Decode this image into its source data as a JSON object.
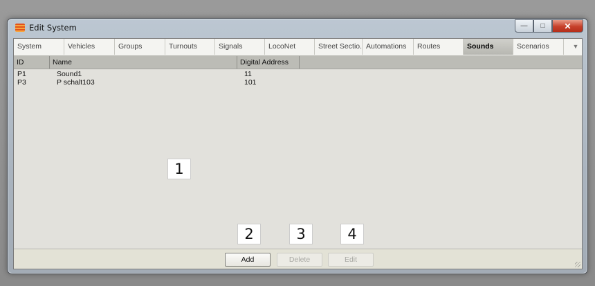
{
  "window": {
    "title": "Edit System",
    "minimize_glyph": "—",
    "maximize_glyph": "□",
    "close_glyph": "✕"
  },
  "tabs": [
    {
      "label": "System"
    },
    {
      "label": "Vehicles"
    },
    {
      "label": "Groups"
    },
    {
      "label": "Turnouts"
    },
    {
      "label": "Signals"
    },
    {
      "label": "LocoNet"
    },
    {
      "label": "Street Sectio.."
    },
    {
      "label": "Automations"
    },
    {
      "label": "Routes"
    },
    {
      "label": "Sounds",
      "active": true
    },
    {
      "label": "Scenarios"
    }
  ],
  "tab_overflow_glyph": "▼",
  "list": {
    "columns": [
      "ID",
      "Name",
      "Digital Address"
    ],
    "rows": [
      [
        "P1",
        "Sound1",
        "11"
      ],
      [
        "P3",
        "P schalt103",
        "101"
      ]
    ]
  },
  "callouts": [
    "1",
    "2",
    "3",
    "4"
  ],
  "buttons": {
    "add": "Add",
    "delete": "Delete",
    "edit": "Edit"
  },
  "colors": {
    "active_tab": "#bdbdb7",
    "close_button": "#c6402a",
    "app_icon": "#e2521c"
  },
  "icons": [
    "app-icon",
    "minimize-icon",
    "maximize-icon",
    "close-icon",
    "chevron-down-icon",
    "resize-grip-icon"
  ]
}
